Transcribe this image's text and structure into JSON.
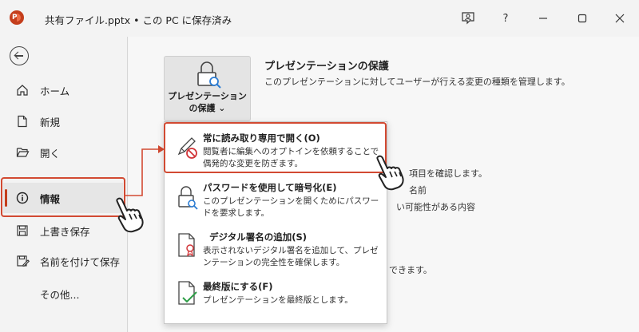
{
  "window": {
    "app_logo_letter": "P",
    "title": "共有ファイル.pptx • この PC に保存済み",
    "help_label": "?",
    "accent_color": "#c43e1c",
    "highlight_color": "#d24a32"
  },
  "nav": {
    "items": [
      {
        "label": "ホーム",
        "icon": "home-icon"
      },
      {
        "label": "新規",
        "icon": "new-document-icon"
      },
      {
        "label": "開く",
        "icon": "folder-open-icon"
      },
      {
        "label": "情報",
        "icon": "info-icon",
        "active": true
      },
      {
        "label": "上書き保存",
        "icon": "save-icon"
      },
      {
        "label": "名前を付けて保存",
        "icon": "save-as-icon"
      },
      {
        "label": "その他...",
        "icon": ""
      }
    ]
  },
  "protect": {
    "button_line1": "プレゼンテーション",
    "button_line2": "の保護 ⌄",
    "section_title": "プレゼンテーションの保護",
    "section_desc": "このプレゼンテーションに対してユーザーが行える変更の種類を管理します。"
  },
  "background_text": {
    "line1": "項目を確認します。",
    "line2": "名前",
    "line3": "い可能性がある内容",
    "line4": "できます。"
  },
  "menu": {
    "items": [
      {
        "title": "常に読み取り専用で開く(O)",
        "desc": "閲覧者に編集へのオプトインを依頼することで偶発的な変更を防ぎます。",
        "icon": "pencil-prohibited-icon"
      },
      {
        "title": "パスワードを使用して暗号化(E)",
        "desc": "このプレゼンテーションを開くためにパスワードを要求します。",
        "icon": "lock-key-icon"
      },
      {
        "title": "デジタル署名の追加(S)",
        "desc": "表示されないデジタル署名を追加して、プレゼンテーションの完全性を確保します。",
        "icon": "certificate-document-icon"
      },
      {
        "title": "最終版にする(F)",
        "desc": "プレゼンテーションを最終版とします。",
        "icon": "document-check-icon"
      }
    ]
  }
}
